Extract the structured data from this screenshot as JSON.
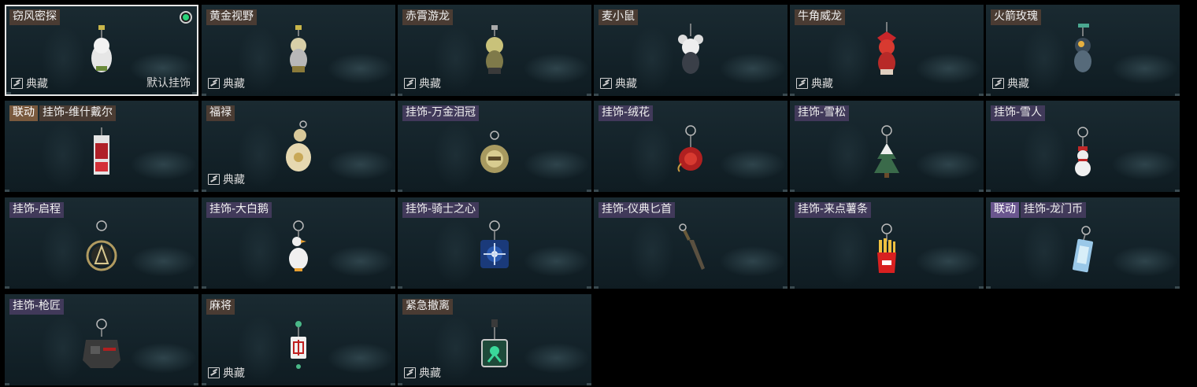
{
  "cards": [
    {
      "label": "窃风密探",
      "collection": "典藏",
      "default_label": "默认挂饰",
      "selected": true
    },
    {
      "label": "黄金视野",
      "collection": "典藏"
    },
    {
      "label": "赤霄游龙",
      "collection": "典藏"
    },
    {
      "label": "麦小鼠",
      "collection": "典藏"
    },
    {
      "label": "牛角威龙",
      "collection": "典藏"
    },
    {
      "label": "火箭玫瑰",
      "collection": "典藏"
    },
    {
      "label": "挂饰-维什戴尔",
      "collab": "联动"
    },
    {
      "label": "福禄",
      "collection": "典藏"
    },
    {
      "label": "挂饰-万金泪冠"
    },
    {
      "label": "挂饰-绒花"
    },
    {
      "label": "挂饰-雪松"
    },
    {
      "label": "挂饰-雪人"
    },
    {
      "label": "挂饰-启程"
    },
    {
      "label": "挂饰-大白鹅"
    },
    {
      "label": "挂饰-骑士之心"
    },
    {
      "label": "挂饰-仪典匕首"
    },
    {
      "label": "挂饰-来点薯条"
    },
    {
      "label": "挂饰-龙门币",
      "collab": "联动"
    },
    {
      "label": "挂饰-枪匠"
    },
    {
      "label": "麻将",
      "collection": "典藏"
    },
    {
      "label": "紧急撤离",
      "collection": "典藏"
    }
  ],
  "icons": {
    "collection": "collection-icon",
    "equipped": "equipped-indicator-icon"
  },
  "colors": {
    "equipped_dot": "#2ad37a",
    "selected_border": "#e8e8e8"
  }
}
